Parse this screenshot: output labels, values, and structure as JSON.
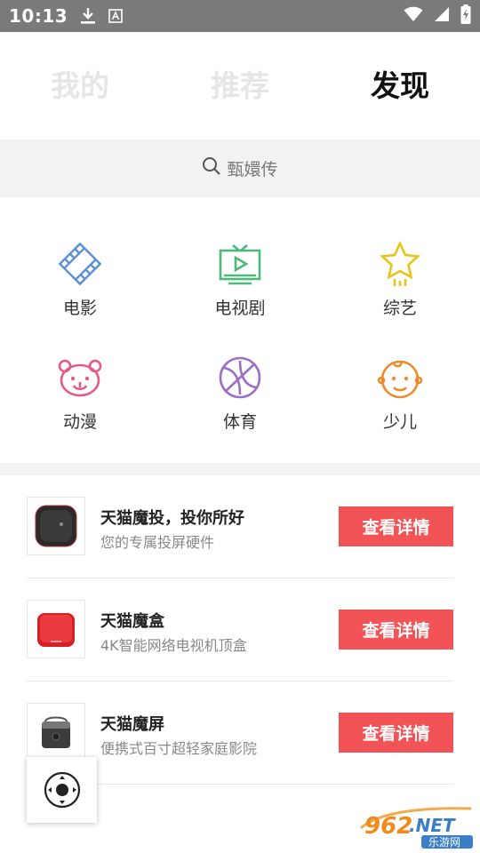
{
  "status_bar": {
    "time": "10:13",
    "icons": [
      "download-icon",
      "a11y-text-icon",
      "wifi-icon",
      "signal-icon",
      "battery-charging-icon"
    ]
  },
  "tabs": [
    {
      "label": "我的",
      "active": false
    },
    {
      "label": "推荐",
      "active": false
    },
    {
      "label": "发现",
      "active": true
    }
  ],
  "search": {
    "placeholder": "甄嬛传",
    "icon": "search-icon"
  },
  "categories": [
    {
      "label": "电影",
      "icon": "film-icon",
      "color": "#5b8fd6"
    },
    {
      "label": "电视剧",
      "icon": "tv-icon",
      "color": "#4cb87a"
    },
    {
      "label": "综艺",
      "icon": "star-icon",
      "color": "#e9c21a"
    },
    {
      "label": "动漫",
      "icon": "bear-icon",
      "color": "#e45a86"
    },
    {
      "label": "体育",
      "icon": "basketball-icon",
      "color": "#9b6fc4"
    },
    {
      "label": "少儿",
      "icon": "kid-face-icon",
      "color": "#ee8a2a"
    }
  ],
  "products": [
    {
      "title": "天猫魔投，投你所好",
      "subtitle": "您的专属投屏硬件",
      "button": "查看详情"
    },
    {
      "title": "天猫魔盒",
      "subtitle": "4K智能网络电视机顶盒",
      "button": "查看详情"
    },
    {
      "title": "天猫魔屏",
      "subtitle": "便携式百寸超轻家庭影院",
      "button": "查看详情"
    }
  ],
  "colors": {
    "accent_button": "#f25356",
    "status_bar": "#7a7a7a",
    "inactive_tab": "#e6e6e6"
  },
  "watermark": {
    "number": "962",
    "suffix": ".NET",
    "caption": "乐游网"
  }
}
